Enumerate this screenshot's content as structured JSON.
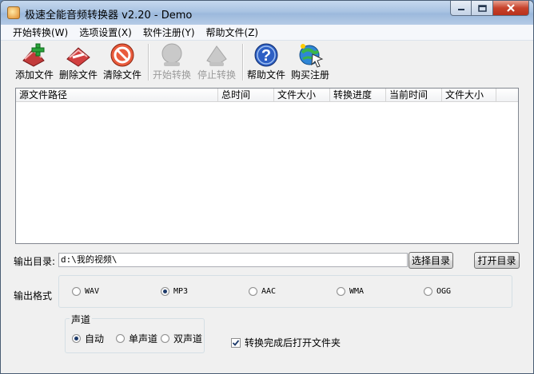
{
  "window": {
    "title": "极速全能音频转换器 v2.20 - Demo"
  },
  "menu": [
    {
      "label": "开始转换(W)"
    },
    {
      "label": "选项设置(X)"
    },
    {
      "label": "软件注册(Y)"
    },
    {
      "label": "帮助文件(Z)"
    }
  ],
  "toolbar": {
    "add": {
      "label": "添加文件",
      "icon": "add-file-icon"
    },
    "delete": {
      "label": "删除文件",
      "icon": "delete-file-icon"
    },
    "clear": {
      "label": "清除文件",
      "icon": "clear-files-icon"
    },
    "start": {
      "label": "开始转换",
      "icon": "start-convert-icon"
    },
    "stop": {
      "label": "停止转换",
      "icon": "stop-convert-icon"
    },
    "help": {
      "label": "帮助文件",
      "icon": "help-icon"
    },
    "buy": {
      "label": "购买注册",
      "icon": "buy-register-icon"
    }
  },
  "file_list": {
    "columns": [
      "源文件路径",
      "总时间",
      "文件大小",
      "转换进度",
      "当前时间",
      "文件大小"
    ],
    "rows": []
  },
  "output": {
    "dir_label": "输出目录:",
    "dir_value": "d:\\我的视频\\",
    "choose_button": "选择目录",
    "open_button": "打开目录"
  },
  "format": {
    "label": "输出格式",
    "selected": "MP3",
    "options": [
      "WAV",
      "MP3",
      "AAC",
      "WMA",
      "OGG"
    ]
  },
  "channel": {
    "title": "声道",
    "selected": "自动",
    "options": [
      "自动",
      "单声道",
      "双声道"
    ]
  },
  "open_folder_after": {
    "label": "转换完成后打开文件夹",
    "checked": true
  }
}
